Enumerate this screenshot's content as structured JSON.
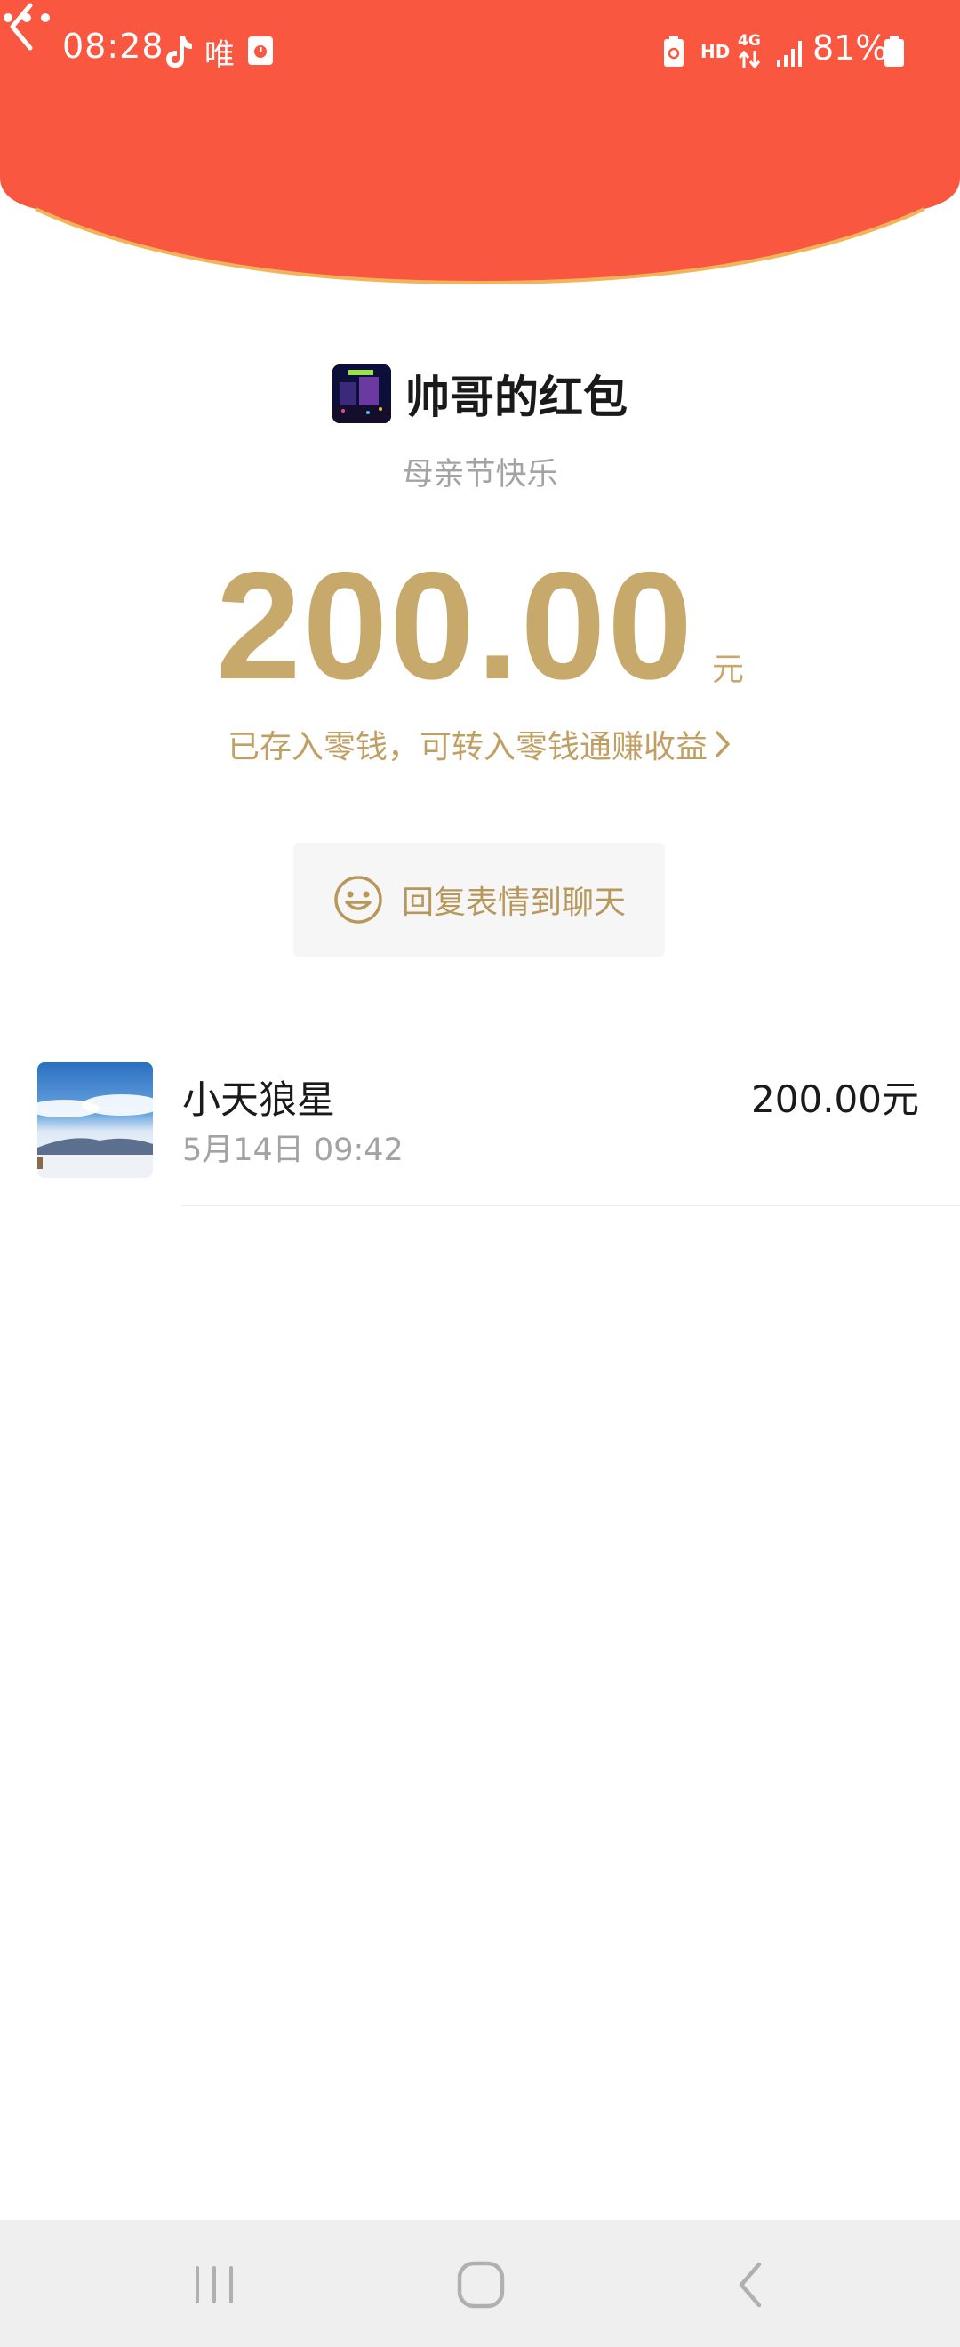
{
  "status_bar": {
    "time": "08:28",
    "notification_icons": [
      "tiktok-icon",
      "wei-app-icon",
      "calendar-icon"
    ],
    "system_icons": [
      "sim-card-icon",
      "hd-icon",
      "4g-icon",
      "signal-icon",
      "battery-icon"
    ],
    "hd_label": "HD",
    "network_label": "4G",
    "battery": "81%"
  },
  "header": {
    "color": "#f9573f",
    "back_icon": "chevron-left-icon",
    "more_icon": "more-icon"
  },
  "envelope": {
    "sender_name": "帅哥的红包",
    "greeting": "母亲节快乐",
    "amount": "200.00",
    "unit": "元",
    "change_text": "已存入零钱，可转入零钱通赚收益",
    "accent_color": "#c8a96c"
  },
  "reply_button": {
    "icon": "smiley-icon",
    "label": "回复表情到聊天"
  },
  "records": [
    {
      "name": "小天狼星",
      "time": "5月14日  09:42",
      "amount": "200.00元"
    }
  ],
  "navbar": {
    "buttons": [
      "recent-apps-icon",
      "home-icon",
      "back-icon"
    ]
  }
}
